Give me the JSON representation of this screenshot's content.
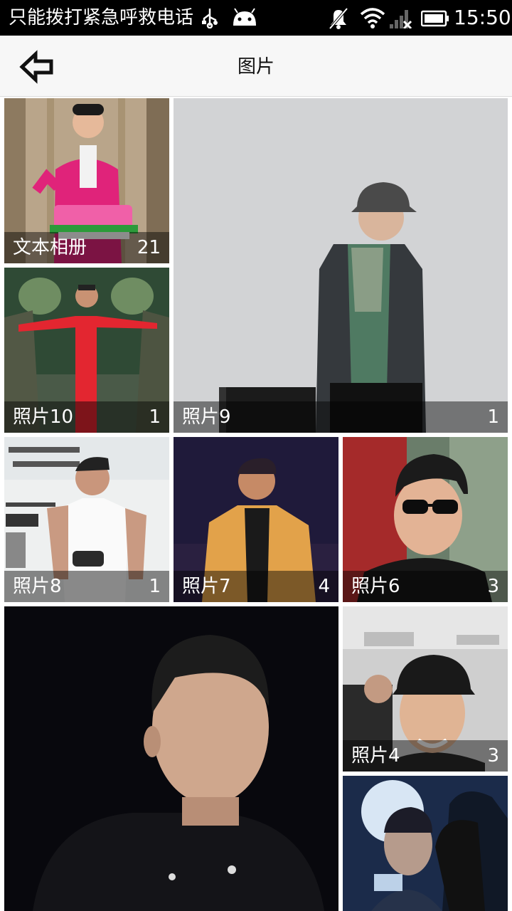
{
  "status_bar": {
    "carrier_text": "只能拨打紧急呼救电话",
    "time": "15:50",
    "icons": [
      "usb-icon",
      "android-icon",
      "mute-icon",
      "wifi-icon",
      "signal-icon",
      "battery-icon"
    ]
  },
  "app_bar": {
    "title": "图片",
    "back_icon": "back-arrow-icon"
  },
  "albums": [
    {
      "name": "文本相册",
      "count": "21"
    },
    {
      "name": "照片10",
      "count": "1"
    },
    {
      "name": "照片9",
      "count": "1"
    },
    {
      "name": "照片8",
      "count": "1"
    },
    {
      "name": "照片7",
      "count": "4"
    },
    {
      "name": "照片6",
      "count": "3"
    },
    {
      "name": "照片4",
      "count": "3"
    }
  ],
  "colors": {
    "status_bar_bg": "#000000",
    "app_bar_bg": "#f7f7f7",
    "caption_overlay": "rgba(0,0,0,0.45)"
  }
}
